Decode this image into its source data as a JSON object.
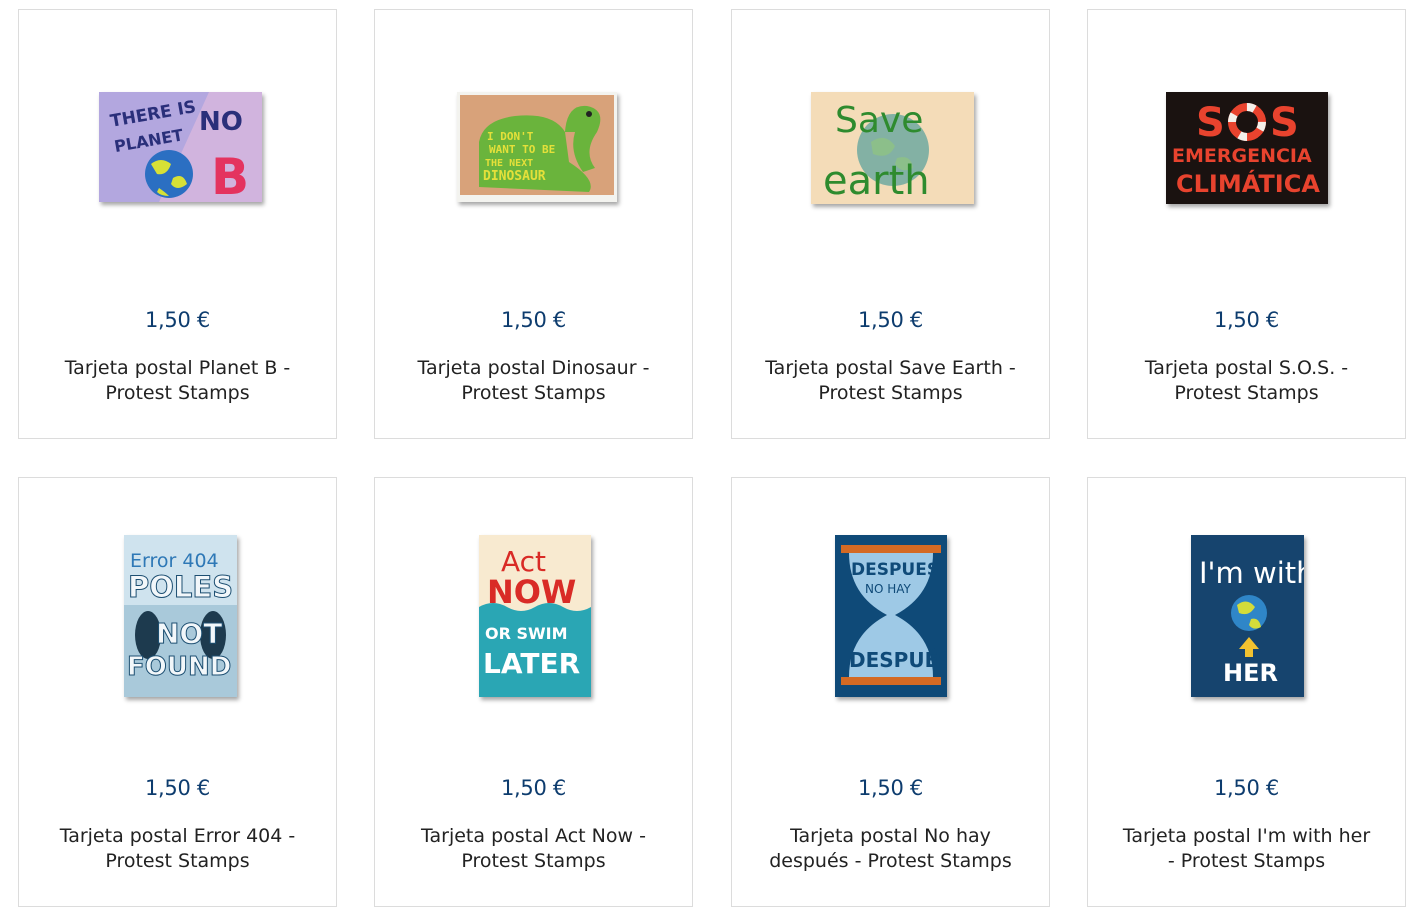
{
  "products": [
    {
      "price": "1,50 €",
      "title": "Tarjeta postal Planet B - Protest Stamps",
      "image_text": "THERE IS NO PLANET B"
    },
    {
      "price": "1,50 €",
      "title": "Tarjeta postal Dinosaur - Protest Stamps",
      "image_text": "I DON'T WANT TO BE THE NEXT DINOSAUR"
    },
    {
      "price": "1,50 €",
      "title": "Tarjeta postal Save Earth - Protest Stamps",
      "image_text": "Save earth"
    },
    {
      "price": "1,50 €",
      "title": "Tarjeta postal S.O.S. - Protest Stamps",
      "image_text": "SOS EMERGENCIA CLIMÁTICA"
    },
    {
      "price": "1,50 €",
      "title": "Tarjeta postal Error 404 - Protest Stamps",
      "image_text": "Error 404 POLES NOT FOUND"
    },
    {
      "price": "1,50 €",
      "title": "Tarjeta postal Act Now - Protest Stamps",
      "image_text": "Act NOW OR SWIM LATER"
    },
    {
      "price": "1,50 €",
      "title": "Tarjeta postal No hay después - Protest Stamps",
      "image_text": "DESPUES NO HAY DESPUÉS"
    },
    {
      "price": "1,50 €",
      "title": "Tarjeta postal I'm with her - Protest Stamps",
      "image_text": "I'm with HER"
    }
  ],
  "colors": {
    "price": "#0d3c6e",
    "title": "#222222",
    "card_border": "#dcdcdc"
  }
}
